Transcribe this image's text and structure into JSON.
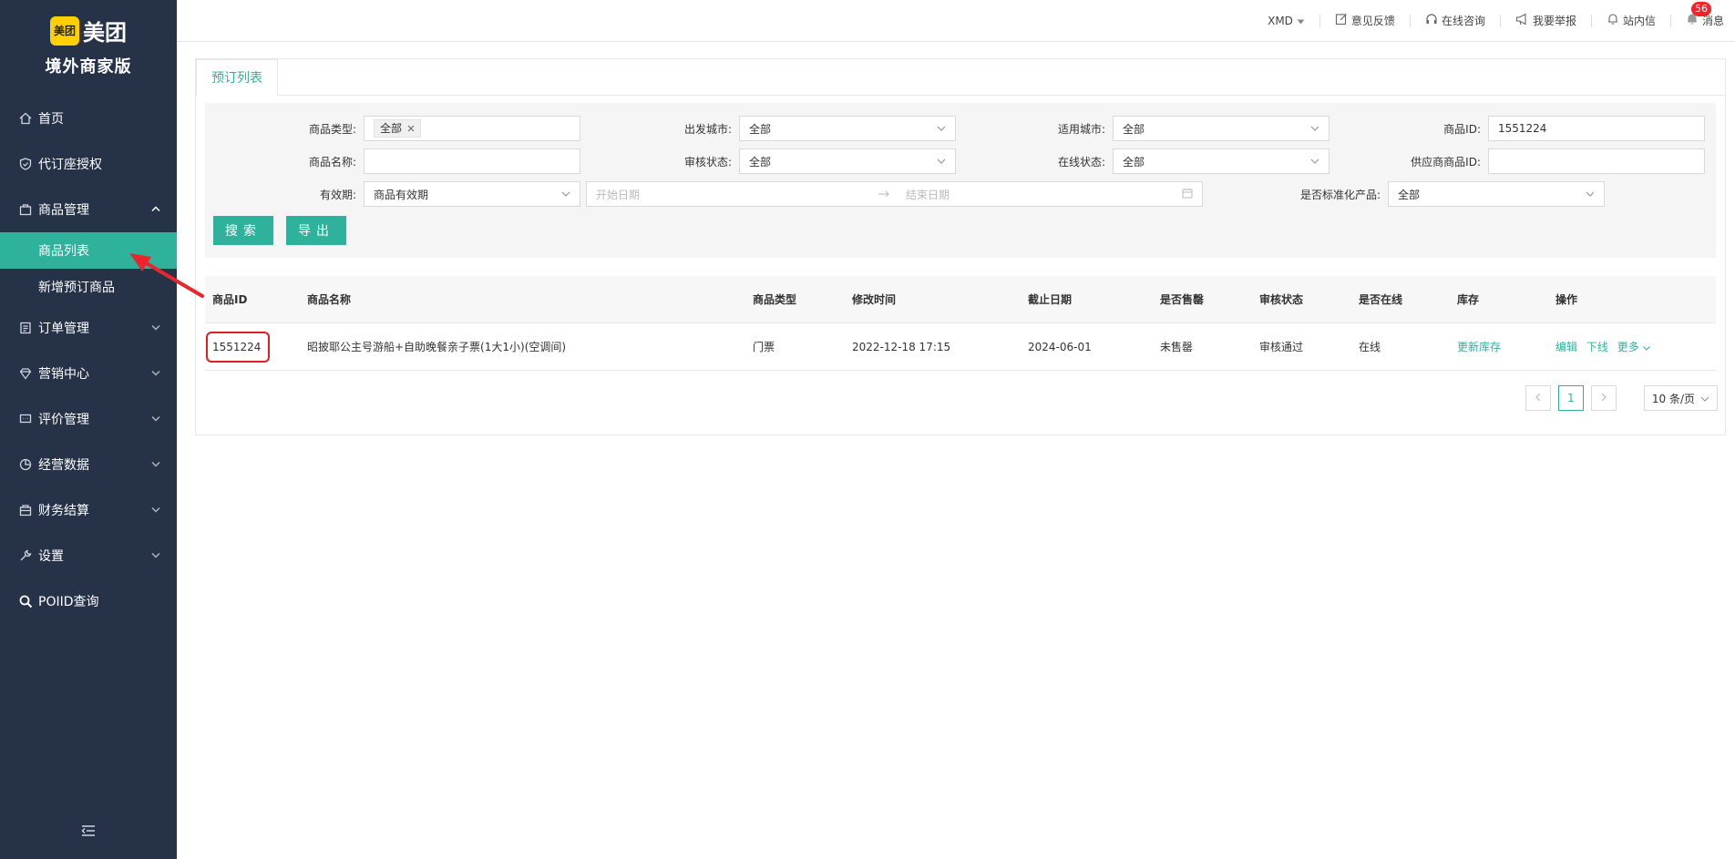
{
  "brand": {
    "logo_mark": "美团",
    "logo_text": "美团",
    "subtitle": "境外商家版"
  },
  "sidebar": {
    "items": [
      {
        "label": "首页",
        "icon": "home-icon"
      },
      {
        "label": "代订座授权",
        "icon": "shield-icon"
      },
      {
        "label": "商品管理",
        "icon": "bag-icon",
        "expanded": true,
        "children": [
          {
            "label": "商品列表",
            "active": true
          },
          {
            "label": "新增预订商品"
          }
        ]
      },
      {
        "label": "订单管理",
        "icon": "order-icon"
      },
      {
        "label": "营销中心",
        "icon": "diamond-icon"
      },
      {
        "label": "评价管理",
        "icon": "comment-icon"
      },
      {
        "label": "经营数据",
        "icon": "pie-icon"
      },
      {
        "label": "财务结算",
        "icon": "wallet-icon"
      },
      {
        "label": "设置",
        "icon": "wrench-icon"
      },
      {
        "label": "POIID查询",
        "icon": "search-icon"
      }
    ]
  },
  "header": {
    "currency": "XMD",
    "feedback": "意见反馈",
    "consult": "在线咨询",
    "report": "我要举报",
    "inbox": "站内信",
    "messages": "消息",
    "message_count": "56"
  },
  "main": {
    "tab": "预订列表",
    "filters": {
      "product_type_label": "商品类型:",
      "product_type_tag": "全部",
      "depart_city_label": "出发城市:",
      "depart_city_value": "全部",
      "apply_city_label": "适用城市:",
      "apply_city_value": "全部",
      "product_id_label": "商品ID:",
      "product_id_value": "1551224",
      "product_name_label": "商品名称:",
      "audit_label": "审核状态:",
      "audit_value": "全部",
      "online_label": "在线状态:",
      "online_value": "全部",
      "supplier_id_label": "供应商商品ID:",
      "validity_label": "有效期:",
      "validity_value": "商品有效期",
      "start_date_ph": "开始日期",
      "end_date_ph": "结束日期",
      "standard_label": "是否标准化产品:",
      "standard_value": "全部"
    },
    "buttons": {
      "search": "搜索",
      "export": "导出"
    },
    "table": {
      "columns": [
        "商品ID",
        "商品名称",
        "商品类型",
        "修改时间",
        "截止日期",
        "是否售罄",
        "审核状态",
        "是否在线",
        "库存",
        "操作"
      ],
      "rows": [
        {
          "id": "1551224",
          "name": "昭披耶公主号游船+自助晚餐亲子票(1大1小)(空调间)",
          "type": "门票",
          "modified": "2022-12-18 17:15",
          "deadline": "2024-06-01",
          "soldout": "未售罄",
          "audit": "审核通过",
          "online": "在线",
          "stock_action": "更新库存",
          "actions": {
            "edit": "编辑",
            "offline": "下线",
            "more": "更多"
          }
        }
      ]
    },
    "pagination": {
      "current": "1",
      "page_size": "10 条/页"
    }
  }
}
